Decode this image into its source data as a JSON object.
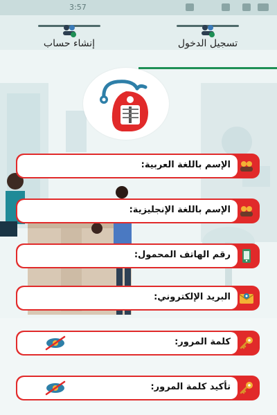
{
  "status_bar": {
    "time": "3:57"
  },
  "tabs": {
    "register": {
      "label": "إنشاء حساب",
      "icon": "users-add-icon"
    },
    "login": {
      "label": "تسجيل الدخول",
      "icon": "users-login-icon"
    }
  },
  "logo": {
    "icon": "medical-xray-stethoscope-logo"
  },
  "fields": {
    "name_arabic": {
      "label": "الإسم باللغة العربية:",
      "icon": "people-icon"
    },
    "name_english": {
      "label": "الإسم باللغة الإنجليزية:",
      "icon": "people-icon"
    },
    "mobile_phone": {
      "label": "رقم الهاتف المحمول:",
      "icon": "phone-icon"
    },
    "email": {
      "label": "البريد الإلكتروني:",
      "icon": "email-icon"
    },
    "password": {
      "label": "كلمة المرور:",
      "icon": "key-icon",
      "toggle_icon": "eye-hidden-icon"
    },
    "confirm_password": {
      "label": "تأكيد كلمة المرور:",
      "icon": "key-icon",
      "toggle_icon": "eye-hidden-icon"
    }
  },
  "colors": {
    "accent": "#e12a2a",
    "tab_indicator": "#1e8f55",
    "background": "#eaf3f3"
  }
}
